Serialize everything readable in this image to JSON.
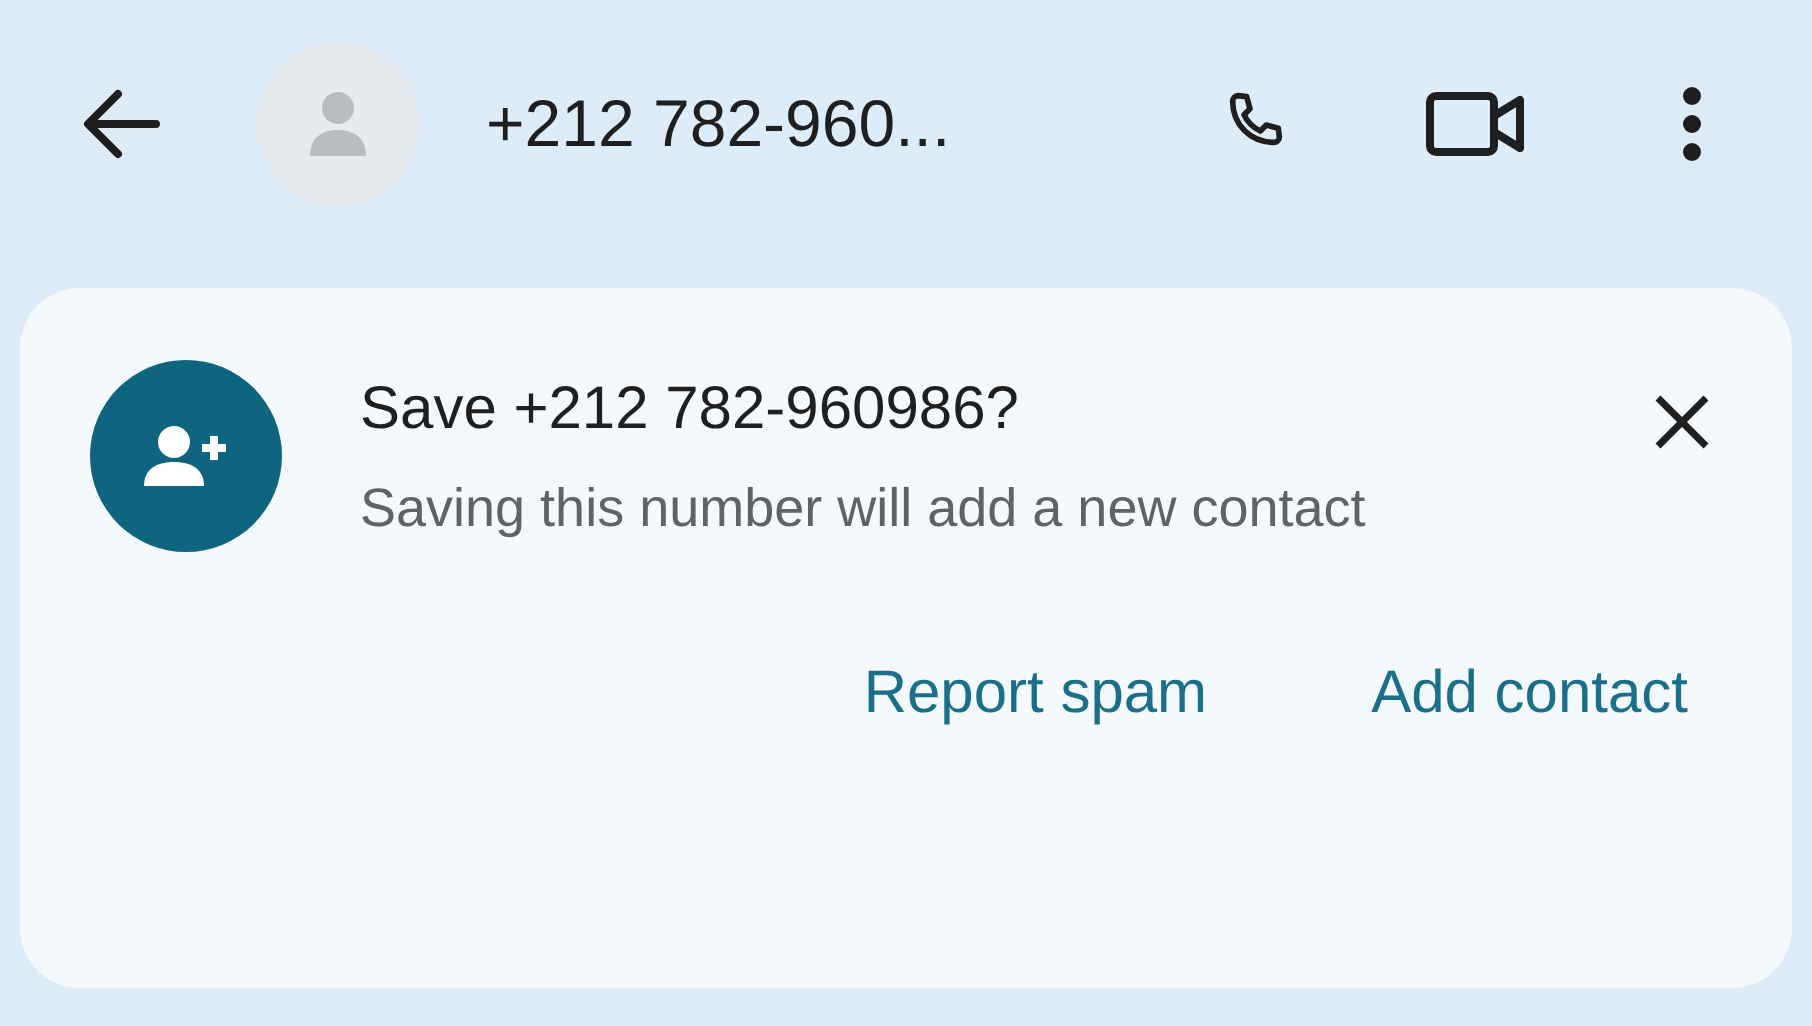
{
  "header": {
    "title": "+212 782-960..."
  },
  "banner": {
    "title": "Save +212 782-960986?",
    "message": "Saving this number will add a new contact",
    "actions": [
      {
        "label": "Report spam"
      },
      {
        "label": "Add contact"
      }
    ]
  }
}
